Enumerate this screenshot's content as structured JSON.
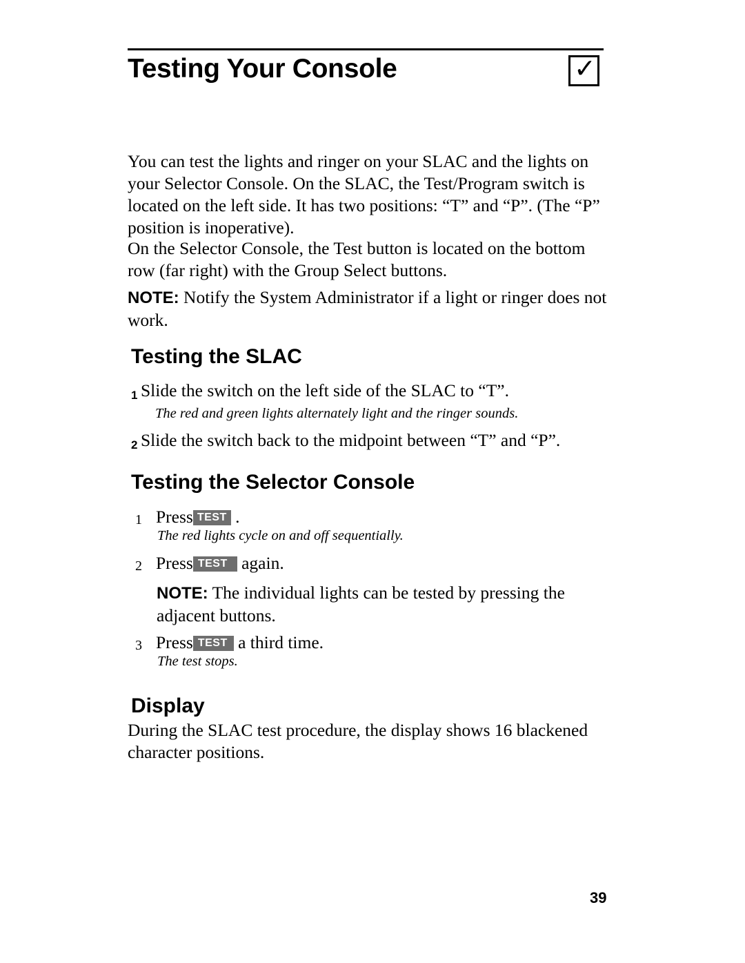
{
  "document": {
    "title": "Testing Your Console",
    "checkbox_icon": "checkmark-icon",
    "page_number": "39",
    "intro_paragraph": "You can test the lights and ringer on your SLAC and the lights on your Selector Console.  On the SLAC, the Test/Program switch is located on the left side. It has two positions: “T” and “P”. (The “P” position is inoperative).",
    "console_paragraph": "On the Selector Console, the Test button is located on the bottom row (far right) with the Group Select buttons.",
    "note_label": "NOTE:",
    "note_text": " Notify the System Administrator if a light or ringer does not work.",
    "sections": [
      {
        "heading": "Testing the SLAC",
        "steps": [
          {
            "num": "1",
            "text": "Slide the switch on the left side of the SLAC to “T”."
          },
          {
            "num": "2",
            "text": "Slide the switch back to the midpoint between “T” and “P”."
          }
        ],
        "italic_1": "The red and green lights alternately light and the ringer sounds."
      },
      {
        "heading": "Testing the Selector Console",
        "key_label": "TEST",
        "steps": [
          {
            "num": "1",
            "pre": "Press ",
            "post": " ."
          },
          {
            "num": "2",
            "pre": "Press ",
            "post": " again."
          },
          {
            "num": "3",
            "pre": "Press ",
            "post": " a  third  time."
          }
        ],
        "italic_1": "The red lights cycle on and off sequentially.",
        "italic_2": "The test stops.",
        "note_label": "NOTE:",
        "note_text": " The individual lights can be tested by pressing the adjacent buttons."
      },
      {
        "heading": "Display",
        "paragraph": "During the SLAC test procedure, the display shows 16 blackened character  positions."
      }
    ]
  }
}
